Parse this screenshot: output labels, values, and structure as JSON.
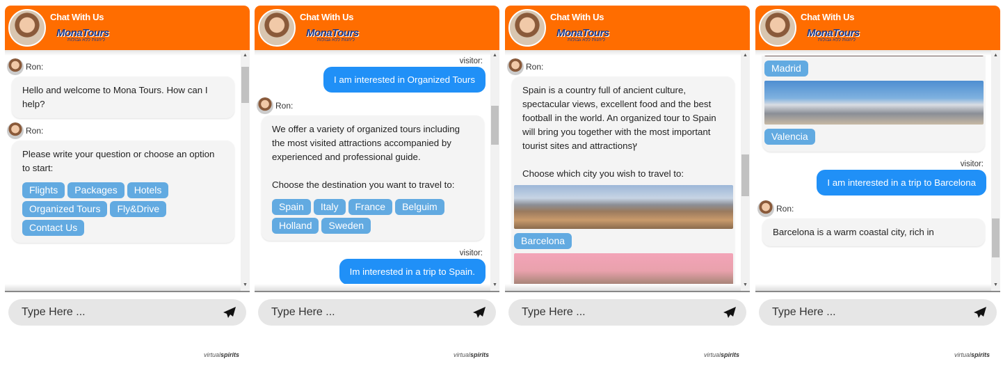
{
  "header": {
    "title": "Chat With Us",
    "logo_text": "MonaTours",
    "logo_tagline": "ליהנות ללא גבולות"
  },
  "input": {
    "placeholder": "Type Here ..."
  },
  "branding": {
    "prefix": "virtual",
    "suffix": "spirits"
  },
  "colors": {
    "header": "#ff6d00",
    "visitor_bubble": "#2090f7",
    "option_button": "#62aae1"
  },
  "panels": [
    {
      "messages": [
        {
          "type": "agent",
          "name": "Ron:",
          "text": "Hello and welcome to Mona Tours. How can I help?"
        },
        {
          "type": "agent",
          "name": "Ron:",
          "text": "Please write your question or choose an option to start:",
          "options": [
            "Flights",
            "Packages",
            "Hotels",
            "Organized Tours",
            "Fly&Drive",
            "Contact Us"
          ]
        }
      ]
    },
    {
      "messages": [
        {
          "type": "visitor",
          "name": "visitor:",
          "text": "I am interested in Organized Tours"
        },
        {
          "type": "agent",
          "name": "Ron:",
          "text": "We offer a variety of organized tours including the most visited attractions accompanied by experienced and professional guide.\n\nChoose the destination you want to travel to:",
          "options": [
            "Spain",
            "Italy",
            "France",
            "Belguim",
            "Holland",
            "Sweden"
          ]
        },
        {
          "type": "visitor",
          "name": "visitor:",
          "text": "Im interested in a trip to Spain."
        }
      ]
    },
    {
      "messages": [
        {
          "type": "agent",
          "name": "Ron:",
          "text": "Spain is a country full of ancient culture, spectacular views, excellent food and the best football in the world. An organized tour to Spain will bring you together with the most important tourist sites and attractionsץ\n\nChoose which city you wish to travel to:",
          "images": [
            {
              "scene": "barcelona",
              "label": "Barcelona"
            },
            {
              "scene": "madrid",
              "label": ""
            }
          ]
        }
      ]
    },
    {
      "messages": [
        {
          "type": "agent",
          "name": "",
          "text": "",
          "images": [
            {
              "scene": "madrid",
              "label": "Madrid"
            },
            {
              "scene": "valencia",
              "label": "Valencia"
            }
          ]
        },
        {
          "type": "visitor",
          "name": "visitor:",
          "text": "I am interested in a trip to Barcelona"
        },
        {
          "type": "agent",
          "name": "Ron:",
          "text": "Barcelona is a warm coastal city, rich in"
        }
      ]
    }
  ]
}
